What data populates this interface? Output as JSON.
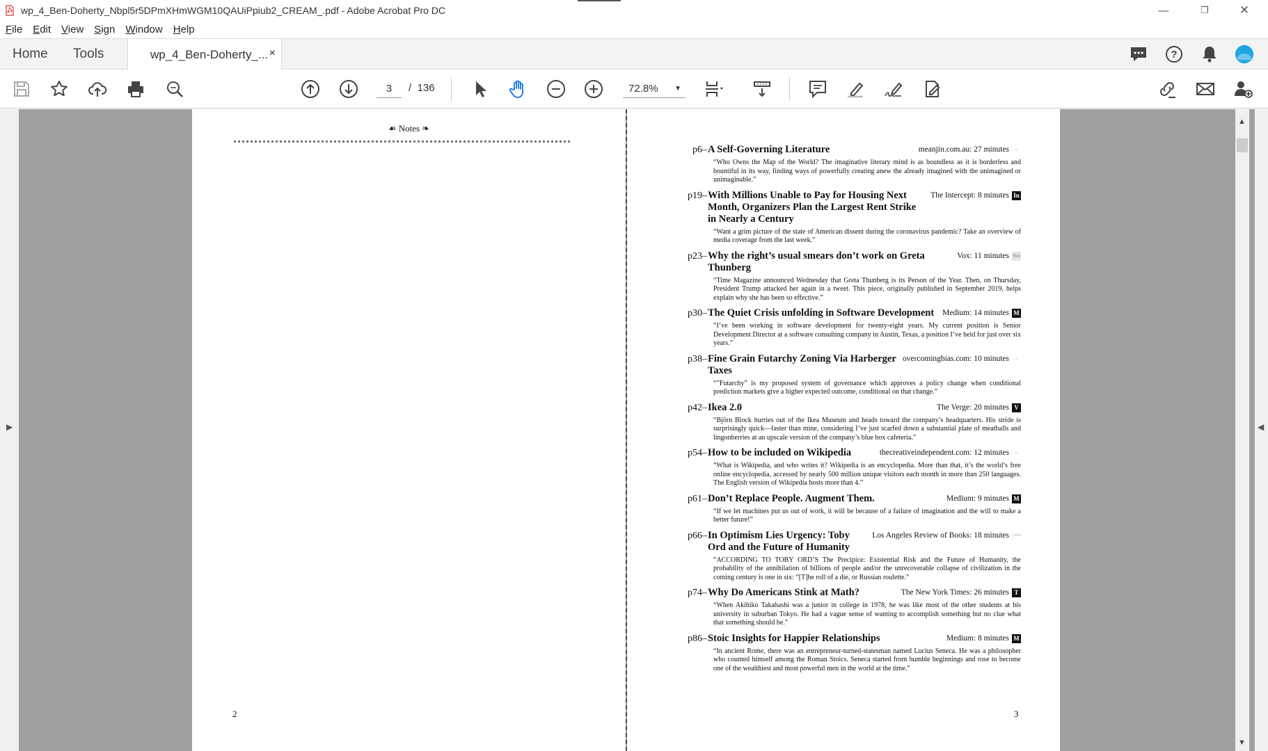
{
  "window": {
    "title": "wp_4_Ben-Doherty_Nbpl5r5DPmXHmWGM10QAUiPpiub2_CREAM_.pdf - Adobe Acrobat Pro DC",
    "minimize": "—",
    "restore": "❐",
    "close": "✕"
  },
  "menu": [
    "File",
    "Edit",
    "View",
    "Sign",
    "Window",
    "Help"
  ],
  "tabs": {
    "home": "Home",
    "tools": "Tools",
    "document": "wp_4_Ben-Doherty_...",
    "close": "×"
  },
  "toolbar": {
    "current_page": "3",
    "page_separator": "/",
    "total_pages": "136",
    "zoom": "72.8%"
  },
  "colors": {
    "accent": "#1473e6",
    "avatar": "#1fa6e0"
  },
  "left_page": {
    "heading": "☙ Notes ❧",
    "page_number": "2"
  },
  "right_page": {
    "page_number": "3",
    "entries": [
      {
        "ref": "p6–",
        "title": "A Self-Governing Literature",
        "source": "meanjin.com.au: 27 minutes",
        "badge": "◦",
        "badge_style": "none",
        "quote": "“Who Owns the Map of the World? The imaginative literary mind is as boundless as it is borderless and bountiful in its way, finding ways of powerfully creating anew the already imagined with the unimagined or unimaginable.”"
      },
      {
        "ref": "p19–",
        "title": "With Millions Unable to Pay for Housing Next Month, Organizers Plan the Largest Rent Strike in Nearly a Century",
        "source": "The Intercept: 8 minutes",
        "badge": "In",
        "badge_style": "dark",
        "quote": "“Want a grim picture of the state of American dissent during the coronavirus pandemic? Take an overview of media coverage from the last week.”"
      },
      {
        "ref": "p23–",
        "title": "Why the right’s usual smears don’t work on Greta Thunberg",
        "source": "Vox: 11 minutes",
        "badge": "Vox",
        "badge_style": "light",
        "quote": "“Time Magazine announced Wednesday that Greta Thunberg is its Person of the Year. Then, on Thursday, President Trump attacked her again in a tweet. This piece, originally published in September 2019, helps explain why she has been so effective.”"
      },
      {
        "ref": "p30–",
        "title": "The Quiet Crisis unfolding in Software Development",
        "source": "Medium: 14 minutes",
        "badge": "M",
        "badge_style": "dark",
        "quote": "“I’ve been working in software development for twenty-eight years. My current position is Senior Development Director at a software consulting company in Austin, Texas, a position I’ve held for just over six years.”"
      },
      {
        "ref": "p38–",
        "title": "Fine Grain Futarchy Zoning Via Harberger Taxes",
        "source": "overcomingbias.com: 10 minutes",
        "badge": "◦",
        "badge_style": "none",
        "quote": "“”Futarchy” is my proposed system of governance which approves a policy change when conditional prediction markets give a higher expected outcome, conditional on that change.”"
      },
      {
        "ref": "p42–",
        "title": "Ikea 2.0",
        "source": "The Verge: 20 minutes",
        "badge": "V",
        "badge_style": "dark",
        "quote": "“Björn Block hurries out of the Ikea Museum and heads toward the company’s headquarters. His stride is surprisingly quick—faster than mine, considering I’ve just scarfed down a substantial plate of meatballs and lingonberries at an upscale version of the company’s blue box cafeteria.”"
      },
      {
        "ref": "p54–",
        "title": "How to be included on Wikipedia",
        "source": "thecreativeindependent.com: 12 minutes",
        "badge": "◦",
        "badge_style": "none",
        "quote": "“What is Wikipedia, and who writes it? Wikipedia is an encyclopedia. More than that, it’s the world’s free online encyclopedia, accessed by nearly 500 million unique visitors each month in more than 250 languages. The English version of Wikipedia hosts more than 4.”"
      },
      {
        "ref": "p61–",
        "title": "Don’t Replace People. Augment Them.",
        "source": "Medium: 9 minutes",
        "badge": "M",
        "badge_style": "dark",
        "quote": "“If we let machines put us out of work, it will be because of a failure of imagination and the will to make a better future!”"
      },
      {
        "ref": "p66–",
        "title": "In Optimism Lies Urgency: Toby Ord and the Future of Humanity",
        "source": "Los Angeles Review of Books: 18 minutes",
        "badge": "LARB",
        "badge_style": "none",
        "quote": "“ACCORDING TO TOBY ORD’S The Precipice: Existential Risk and the Future of Humanity, the probability of the annihilation of billions of people and/or the unrecoverable collapse of civilization in the coming century is one in six: “[T]he roll of a die, or Russian roulette.”"
      },
      {
        "ref": "p74–",
        "title": "Why Do Americans Stink at Math?",
        "source": "The New York Times: 26 minutes",
        "badge": "T",
        "badge_style": "dark",
        "quote": "“When Akihiko Takahashi was a junior in college in 1978, he was like most of the other students at his university in suburban Tokyo. He had a vague sense of wanting to accomplish something but no clue what that something should be.”"
      },
      {
        "ref": "p86–",
        "title": "Stoic Insights for Happier Relationships",
        "source": "Medium: 8 minutes",
        "badge": "M",
        "badge_style": "dark",
        "quote": "“In ancient Rome, there was an entrepreneur-turned-statesman named Lucius Seneca. He was a philosopher who counted himself among the Roman Stoics. Seneca started from humble beginnings and rose to become one of the wealthiest and most powerful men in the world at the time.”"
      }
    ]
  }
}
